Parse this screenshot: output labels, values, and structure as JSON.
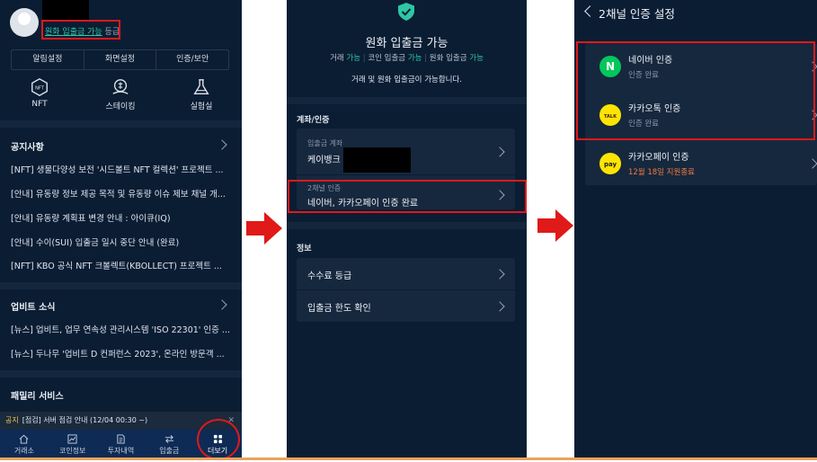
{
  "colors": {
    "background": "#0b1d33",
    "card": "#16283e",
    "accent_green": "#2ec7a4",
    "highlight_red": "#e01919",
    "arrow_red": "#e01919",
    "notice_yellow": "#f2c94c",
    "warning_orange": "#f07a3c",
    "naver_green": "#03c75a",
    "kakao_yellow": "#fee500",
    "nav_bar": "#0e2b55"
  },
  "panel1": {
    "grade_link": "원화 입출금 가능",
    "grade_suffix": " 등급",
    "tabs": [
      "알림설정",
      "화면설정",
      "인증/보안"
    ],
    "quick_menu": [
      {
        "label": "NFT",
        "icon": "nft-icon"
      },
      {
        "label": "스테이킹",
        "icon": "staking-icon"
      },
      {
        "label": "실험실",
        "icon": "flask-icon"
      }
    ],
    "notices_title": "공지사항",
    "notices": [
      "[NFT] 생물다양성 보전 '시드볼트 NFT 컬렉션' 프로젝트 ...",
      "[안내] 유동량 정보 제공 목적 및 유동량 이슈 제보 채널 개...",
      "[안내] 유동량 계획표 변경 안내 : 아이큐(IQ)",
      "[안내] 수이(SUI) 입출금 일시 중단 안내 (완료)",
      "[NFT] KBO 공식 NFT 크볼렉트(KBOLLECT) 프로젝트 ..."
    ],
    "news_title": "업비트 소식",
    "news": [
      "[뉴스] 업비트, 업무 연속성 관리시스템 'ISO 22301' 인증 ...",
      "[뉴스] 두나무 '업비트 D 컨퍼런스 2023', 온라인 방문객 ..."
    ],
    "family_title": "패밀리 서비스",
    "notice_bar": {
      "tag": "공지",
      "text": "[점검] 서버 점검 안내 (12/04 00:30 ~)",
      "close": "✕"
    },
    "bottom_nav": [
      {
        "label": "거래소",
        "icon": "home-icon"
      },
      {
        "label": "코인정보",
        "icon": "chart-icon"
      },
      {
        "label": "투자내역",
        "icon": "document-icon"
      },
      {
        "label": "입출금",
        "icon": "transfer-icon"
      },
      {
        "label": "더보기",
        "icon": "grid-icon"
      }
    ]
  },
  "panel2": {
    "title": "원화 입출금 가능",
    "status_line": [
      {
        "label": "거래",
        "value": "가능"
      },
      {
        "label": "코인 입출금",
        "value": "가능"
      },
      {
        "label": "원화 입출금",
        "value": "가능"
      }
    ],
    "description": "거래 및 원화 입출금이 가능합니다.",
    "account_section": "계좌/인증",
    "deposit_account_label": "입출금 계좌",
    "deposit_account_value": "케이뱅크",
    "two_channel_label": "2채널 인증",
    "two_channel_value": "네이버, 카카오페이 인증 완료",
    "info_section": "정보",
    "fee_grade": "수수료 등급",
    "limit_check": "입출금 한도 확인"
  },
  "panel3": {
    "title": "2채널 인증 설정",
    "methods": [
      {
        "name": "네이버 인증",
        "status": "인증 완료",
        "logo_text": "N"
      },
      {
        "name": "카카오톡 인증",
        "status": "인증 완료",
        "logo_text": "TALK"
      },
      {
        "name": "카카오페이 인증",
        "status": "12월 18일 지원종료",
        "logo_text": "pay"
      }
    ]
  }
}
